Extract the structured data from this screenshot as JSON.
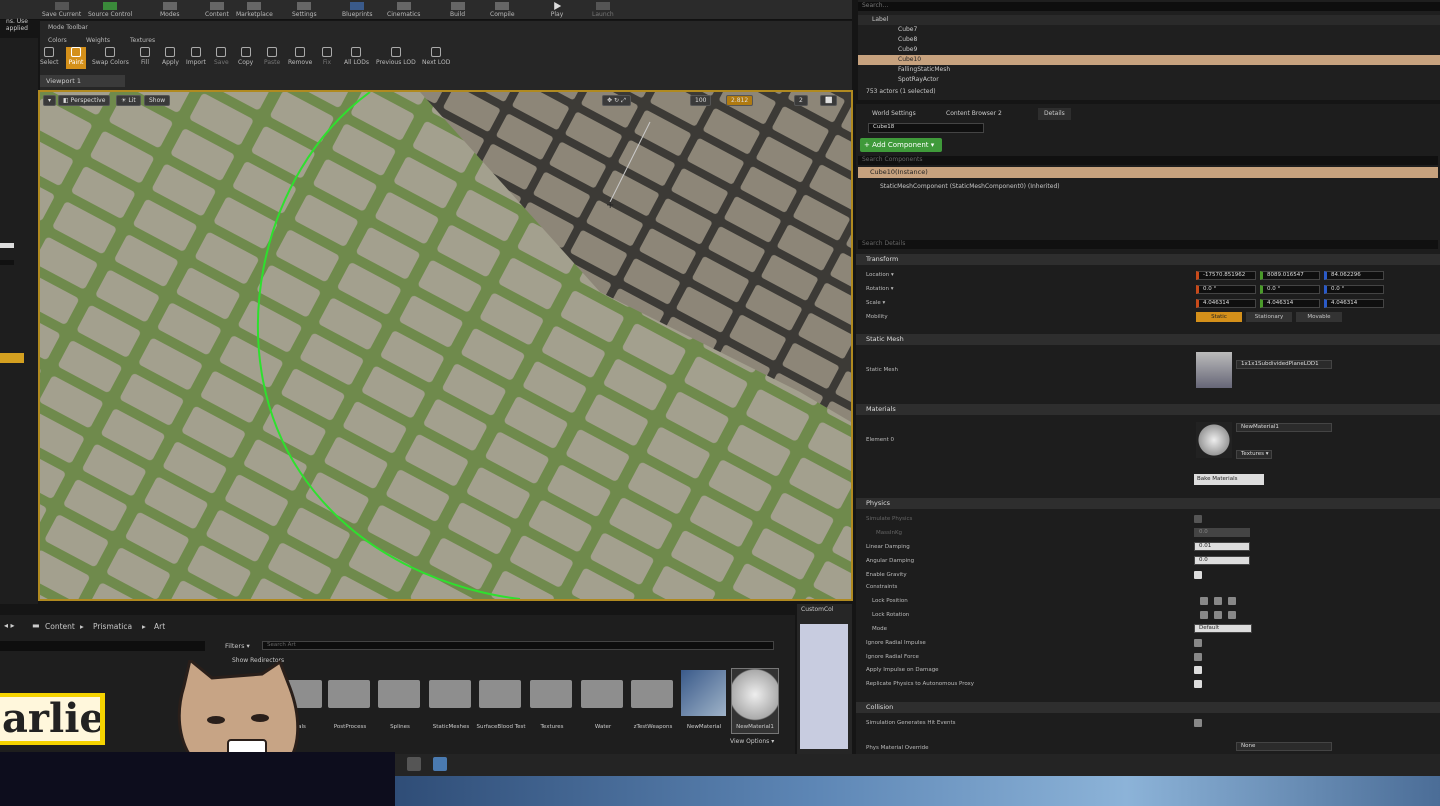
{
  "toolbar": {
    "items": [
      "Save Current",
      "Source Control",
      "Modes",
      "Content",
      "Marketplace",
      "Settings",
      "Blueprints",
      "Cinematics",
      "Build",
      "Compile",
      "Play",
      "Launch"
    ]
  },
  "left_text": {
    "line1": "ns. Use",
    "line2": "applied"
  },
  "mode_toolbar": {
    "title": "Mode Toolbar",
    "tabs": [
      "Colors",
      "Weights",
      "Textures"
    ],
    "tools": [
      "Select",
      "Paint",
      "Swap Colors",
      "Fill",
      "Apply",
      "Import",
      "Save",
      "Copy",
      "Paste",
      "Remove",
      "Fix",
      "All LODs",
      "Previous LOD",
      "Next LOD"
    ]
  },
  "viewport": {
    "tab": "Viewport 1",
    "perspective": "Perspective",
    "lit": "Lit",
    "show": "Show",
    "grid_size": "100",
    "rotation": "10°",
    "scale": "2.812",
    "camera_speed": "2"
  },
  "outliner": {
    "search_placeholder": "Search...",
    "column": "Label",
    "rows": [
      "Cube7",
      "Cube8",
      "Cube9",
      "Cube10",
      "FallingStaticMesh",
      "SpotRayActor"
    ],
    "selected": "Cube10",
    "status": "753 actors (1 selected)"
  },
  "details": {
    "tabs": [
      "World Settings",
      "Content Browser 2",
      "Details"
    ],
    "actor_name": "Cube18",
    "add_component": "+ Add Component ▾",
    "search_components": "Search Components",
    "instance": "Cube10(Instance)",
    "component": "StaticMeshComponent (StaticMeshComponent0) (Inherited)",
    "search_details": "Search Details",
    "transform": {
      "header": "Transform",
      "location_label": "Location ▾",
      "location": [
        "-17570.851962",
        "8089.016547",
        "84.062296"
      ],
      "rotation_label": "Rotation ▾",
      "rotation": [
        "0.0 °",
        "0.0 °",
        "0.0 °"
      ],
      "scale_label": "Scale ▾",
      "scale": [
        "4.046314",
        "4.046314",
        "4.046314"
      ],
      "mobility_label": "Mobility",
      "mobility": [
        "Static",
        "Stationary",
        "Movable"
      ]
    },
    "static_mesh": {
      "header": "Static Mesh",
      "label": "Static Mesh",
      "value": "1x1x1SubdividedPlaneLOD1"
    },
    "materials": {
      "header": "Materials",
      "element": "Element 0",
      "value": "NewMaterial1",
      "textures": "Textures ▾",
      "bake": "Bake Materials"
    },
    "physics": {
      "header": "Physics",
      "simulate": "Simulate Physics",
      "mass": "MassInKg",
      "mass_value": "0.0",
      "linear_damping": "Linear Damping",
      "linear_value": "0.01",
      "angular_damping": "Angular Damping",
      "angular_value": "0.0",
      "enable_gravity": "Enable Gravity",
      "constraints": "Constraints",
      "lock_position": "Lock Position",
      "lock_rotation": "Lock Rotation",
      "mode": "Mode",
      "mode_value": "Default",
      "ignore_radial_impulse": "Ignore Radial Impulse",
      "ignore_radial_force": "Ignore Radial Force",
      "apply_impulse": "Apply Impulse on Damage",
      "replicate": "Replicate Physics to Autonomous Proxy"
    },
    "collision": {
      "header": "Collision",
      "sim_hit": "Simulation Generates Hit Events",
      "phys_mat": "Phys Material Override",
      "phys_value": "None"
    }
  },
  "content_browser": {
    "path": [
      "Content",
      "Prismatica",
      "Art"
    ],
    "filters": "Filters ▾",
    "search_placeholder": "Search Art",
    "show_redirectors": "Show Redirectors",
    "folders": [
      "als",
      "PostProcess",
      "Splines",
      "StaticMeshes",
      "SurfaceBlood Test",
      "Textures",
      "Water",
      "zTestWeapons"
    ],
    "assets": [
      "NewMaterial",
      "NewMaterial1"
    ],
    "view_options": "View Options ▾",
    "custom": "CustomCol"
  },
  "stream": {
    "name": "arlie"
  }
}
